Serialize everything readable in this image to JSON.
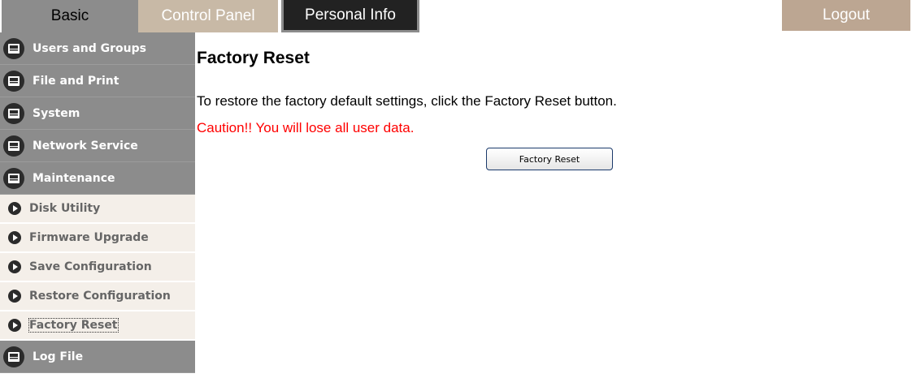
{
  "tabs": {
    "basic": "Basic",
    "control_panel": "Control Panel",
    "personal_info": "Personal Info",
    "logout": "Logout"
  },
  "sidebar": {
    "categories_top": [
      {
        "label": "Users and Groups",
        "icon": "folder-icon"
      },
      {
        "label": "File and Print",
        "icon": "folder-icon"
      },
      {
        "label": "System",
        "icon": "folder-icon"
      },
      {
        "label": "Network Service",
        "icon": "folder-icon"
      },
      {
        "label": "Maintenance",
        "icon": "folder-icon"
      }
    ],
    "maintenance_items": [
      {
        "label": "Disk Utility"
      },
      {
        "label": "Firmware Upgrade"
      },
      {
        "label": "Save Configuration"
      },
      {
        "label": "Restore Configuration"
      },
      {
        "label": "Factory Reset",
        "active": true
      }
    ],
    "categories_bottom": [
      {
        "label": "Log File",
        "icon": "folder-icon"
      }
    ]
  },
  "main": {
    "title": "Factory Reset",
    "description": "To restore the factory default settings, click the Factory Reset button.",
    "caution": "Caution!! You will lose all user data.",
    "button_label": "Factory Reset"
  },
  "colors": {
    "caution": "#ff0000",
    "sidebar_category_bg": "#8c8c8c",
    "sidebar_item_bg": "#f4efe9",
    "control_tab_bg": "#c8b9a6",
    "logout_bg": "#bca692"
  }
}
